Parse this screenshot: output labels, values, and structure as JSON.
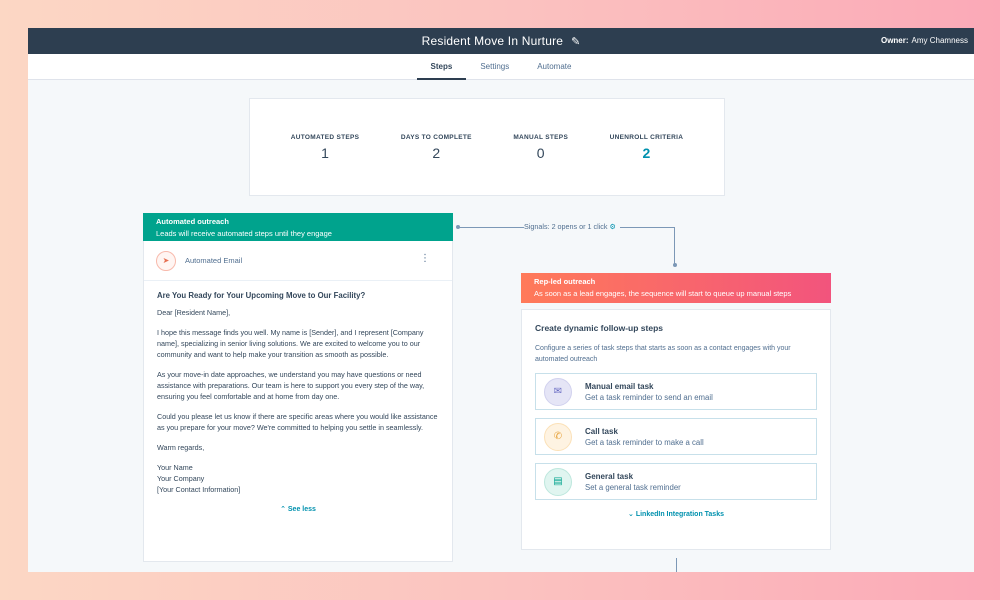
{
  "header": {
    "title": "Resident Move In Nurture",
    "owner_label": "Owner:",
    "owner_name": "Amy Chamness"
  },
  "tabs": [
    {
      "label": "Steps",
      "active": true
    },
    {
      "label": "Settings",
      "active": false
    },
    {
      "label": "Automate",
      "active": false
    }
  ],
  "stats": [
    {
      "label": "AUTOMATED STEPS",
      "value": "1"
    },
    {
      "label": "DAYS TO COMPLETE",
      "value": "2"
    },
    {
      "label": "MANUAL STEPS",
      "value": "0"
    },
    {
      "label": "UNENROLL CRITERIA",
      "value": "2"
    }
  ],
  "automated": {
    "title": "Automated outreach",
    "subtitle": "Leads will receive automated steps until they engage",
    "step_name": "Automated Email",
    "subject": "Are You Ready for Your Upcoming Move to Our Facility?",
    "greeting": "Dear [Resident Name],",
    "paragraphs": [
      "I hope this message finds you well. My name is [Sender], and I represent [Company name], specializing in senior living solutions. We are excited to welcome you to our community and want to help make your transition as smooth as possible.",
      "As your move-in date approaches, we understand you may have questions or need assistance with preparations. Our team is here to support you every step of the way, ensuring you feel comfortable and at home from day one.",
      "Could you please let us know if there are specific areas where you would like assistance as you prepare for your move? We're committed to helping you settle in seamlessly."
    ],
    "closing": "Warm regards,",
    "signature": [
      "Your Name",
      "Your Company",
      "[Your Contact Information]"
    ],
    "see_less": "See less"
  },
  "signals": {
    "text": "Signals: 2 opens or 1 click"
  },
  "rep_led": {
    "title": "Rep-led outreach",
    "subtitle": "As soon as a lead engages, the sequence will start to queue up manual steps",
    "card_title": "Create dynamic follow-up steps",
    "card_desc": "Configure a series of task steps that starts as soon as a contact engages with your automated outreach",
    "tasks": [
      {
        "title": "Manual email task",
        "subtitle": "Get a task reminder to send an email"
      },
      {
        "title": "Call task",
        "subtitle": "Get a task reminder to make a call"
      },
      {
        "title": "General task",
        "subtitle": "Set a general task reminder"
      }
    ],
    "linkedin_link": "LinkedIn Integration Tasks"
  },
  "colors": {
    "automated_header": "#00a38d",
    "rep_header_start": "#ff7a59",
    "rep_header_end": "#f2547d",
    "link": "#0091ae",
    "topbar": "#2d3e50"
  }
}
